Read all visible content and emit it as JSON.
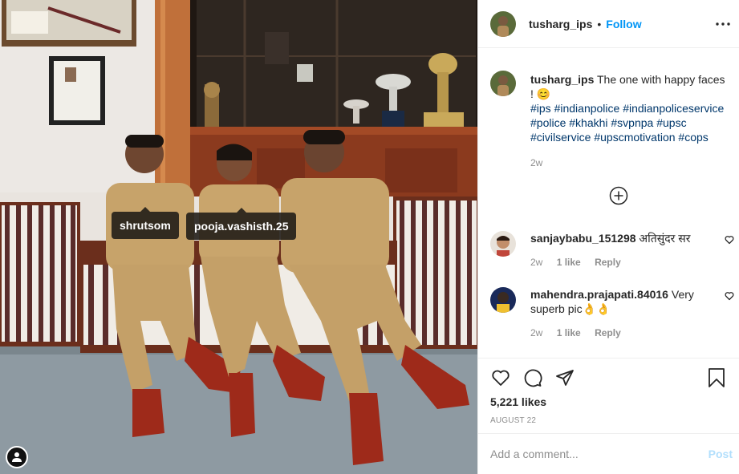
{
  "post": {
    "author": "tusharg_ips",
    "follow_label": "Follow",
    "separator": "•",
    "photo_tags": [
      "shrutsom",
      "pooja.vashisth.25"
    ]
  },
  "caption": {
    "username": "tusharg_ips",
    "text": "The one with happy faces ! 😊",
    "hashtags": "#ips #indianpolice #indianpoliceservice #police #khakhi #svpnpa #upsc #civilservice #upscmotivation #cops",
    "age": "2w"
  },
  "comments": [
    {
      "username": "sanjaybabu_151298",
      "text": "अतिसुंदर सर",
      "age": "2w",
      "likes": "1 like",
      "reply_label": "Reply"
    },
    {
      "username": "mahendra.prajapati.84016",
      "text": "Very superb pic👌👌",
      "age": "2w",
      "likes": "1 like",
      "reply_label": "Reply"
    }
  ],
  "stats": {
    "likes": "5,221 likes",
    "date": "AUGUST 22"
  },
  "composer": {
    "placeholder": "Add a comment...",
    "post_label": "Post"
  },
  "icons": {
    "more": "more-options-icon",
    "load_more": "load-more-comments-icon",
    "like": "heart-icon",
    "comment": "comment-icon",
    "share": "share-icon",
    "save": "bookmark-icon",
    "user_tags": "user-tag-icon"
  },
  "colors": {
    "accent": "#0095f6",
    "hashtag": "#00376b",
    "muted": "#8e8e8e",
    "post_disabled": "#b2dffc"
  }
}
